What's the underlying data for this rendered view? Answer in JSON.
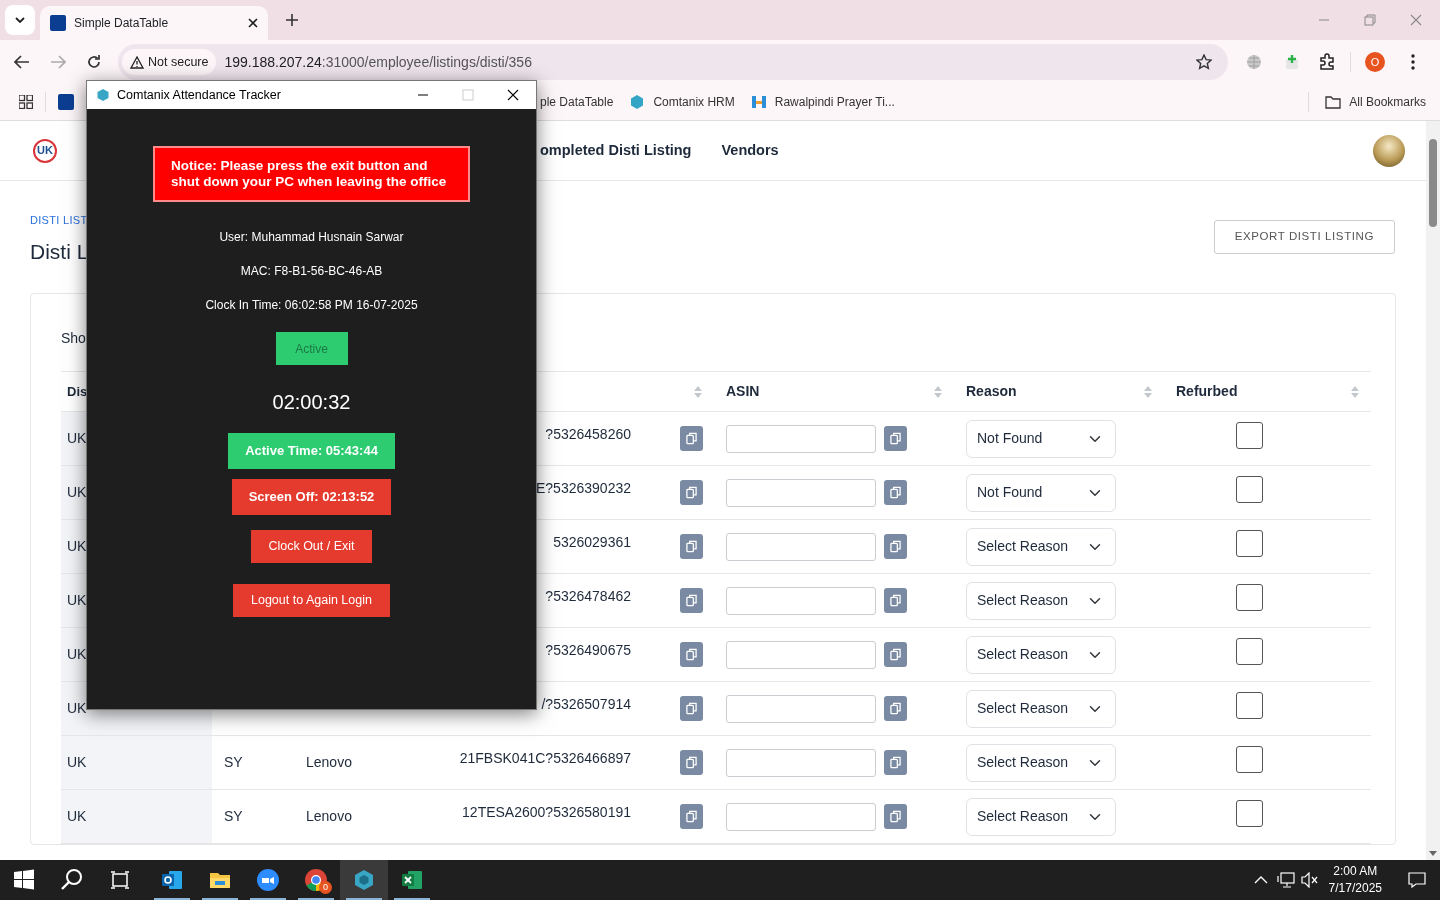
{
  "browser": {
    "tabs": [
      {
        "title": "Simple DataTable",
        "selected": true
      }
    ],
    "security_chip": "Not secure",
    "url_host": "199.188.207.24",
    "url_path": ":31000/employee/listings/disti/356",
    "profile_initial": "O",
    "bookmarks": [
      {
        "kind": "datatable",
        "label": "ple DataTable"
      },
      {
        "kind": "comtanix",
        "label": "Comtanix HRM"
      },
      {
        "kind": "prayer",
        "label": "Rawalpindi Prayer Ti..."
      }
    ],
    "all_bookmarks": "All Bookmarks"
  },
  "page": {
    "logo": "UK",
    "nav": [
      "ompleted Disti Listing",
      "Vendors"
    ],
    "breadcrumb": "DISTI LIST",
    "title": "Disti L",
    "export_button": "EXPORT DISTI LISTING",
    "show_label": "Sho",
    "table": {
      "headers": {
        "column_1": "Dis",
        "asin": "ASIN",
        "reason": "Reason",
        "refurbed": "Refurbed"
      },
      "rows": [
        {
          "column_1": "UK",
          "serial": "?5326458260",
          "reason": "Not Found",
          "refurbed": false
        },
        {
          "column_1": "UK",
          "serial": "E?5326390232",
          "reason": "Not Found",
          "refurbed": false
        },
        {
          "column_1": "UK",
          "serial": "5326029361",
          "reason": "Select Reason",
          "refurbed": false
        },
        {
          "column_1": "UK",
          "serial": "?5326478462",
          "reason": "Select Reason",
          "refurbed": false
        },
        {
          "column_1": "UK",
          "serial": "?5326490675",
          "reason": "Select Reason",
          "refurbed": false
        },
        {
          "column_1": "UK",
          "serial": "/?5326507914",
          "reason": "Select Reason",
          "refurbed": false
        },
        {
          "column_1": "UK",
          "column_2": "SY",
          "brand": "Lenovo",
          "serial": "21FBSK041C?5326466897",
          "reason": "Select Reason",
          "refurbed": false
        },
        {
          "column_1": "UK",
          "column_2": "SY",
          "brand": "Lenovo",
          "serial": "12TESA2600?5326580191",
          "reason": "Select Reason",
          "refurbed": false
        }
      ]
    }
  },
  "tracker": {
    "title": "Comtanix Attendance Tracker",
    "notice": "Notice: Please press the exit button and shut down your PC when leaving the office",
    "info": [
      "User: Muhammad Husnain Sarwar",
      "MAC: F8-B1-56-BC-46-AB",
      "Clock In Time: 06:02:58 PM 16-07-2025"
    ],
    "status": "Active",
    "timer": "02:00:32",
    "active_time": "Active Time: 05:43:44",
    "screen_off": "Screen Off: 02:13:52",
    "buttons": [
      "Clock Out / Exit",
      "Logout to Again Login"
    ]
  },
  "taskbar": {
    "apps": [
      {
        "kind": "outlook",
        "active": false
      },
      {
        "kind": "explorer",
        "active": false
      },
      {
        "kind": "zoom",
        "active": false
      },
      {
        "kind": "chrome",
        "active": false,
        "badge": "0"
      },
      {
        "kind": "tracker",
        "active": true
      },
      {
        "kind": "excel",
        "active": false
      }
    ],
    "time": "2:00 AM",
    "date": "7/17/2025"
  }
}
